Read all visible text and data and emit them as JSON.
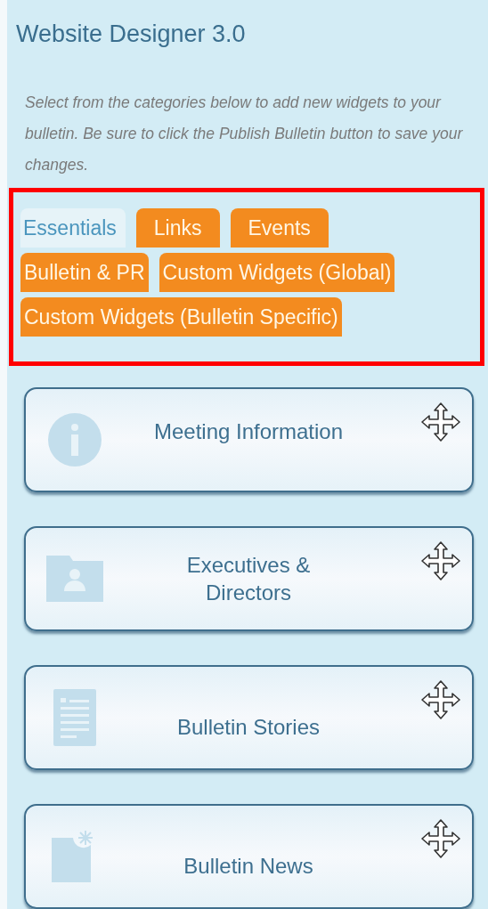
{
  "title": "Website Designer 3.0",
  "description": "Select from the categories below to add new widgets to your bulletin. Be sure to click the Publish Bulletin button to save your changes.",
  "tabs": [
    {
      "label": "Essentials",
      "selected": true
    },
    {
      "label": "Links",
      "selected": false
    },
    {
      "label": "Events",
      "selected": false
    },
    {
      "label": "Bulletin & PR",
      "selected": false
    },
    {
      "label": "Custom Widgets (Global)",
      "selected": false
    },
    {
      "label": "Custom Widgets (Bulletin Specific)",
      "selected": false
    }
  ],
  "widgets": [
    {
      "kind": "info",
      "label": "Meeting Information"
    },
    {
      "kind": "people",
      "label": "Executives & Directors"
    },
    {
      "kind": "document",
      "label": "Bulletin Stories"
    },
    {
      "kind": "news",
      "label": "Bulletin News"
    }
  ]
}
